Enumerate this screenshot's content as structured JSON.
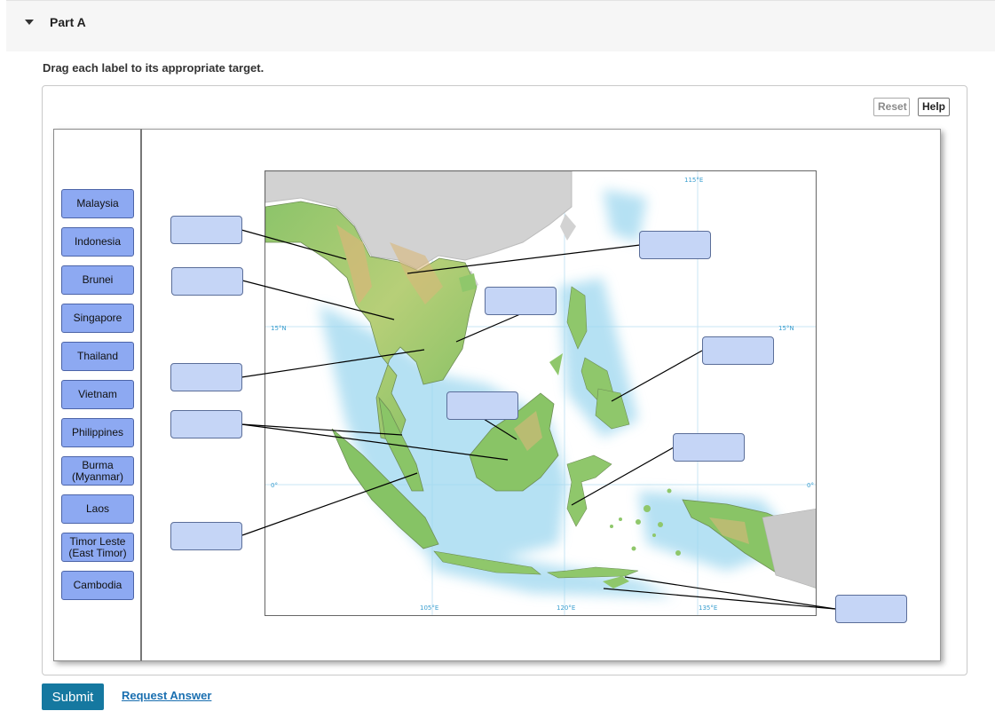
{
  "part": {
    "title": "Part A"
  },
  "instruction": "Drag each label to its appropriate target.",
  "toolbar": {
    "reset_label": "Reset",
    "help_label": "Help"
  },
  "labels": [
    "Malaysia",
    "Indonesia",
    "Brunei",
    "Singapore",
    "Thailand",
    "Vietnam",
    "Philippines",
    "Burma (Myanmar)",
    "Laos",
    "Timor Leste (East Timor)",
    "Cambodia"
  ],
  "map": {
    "coordinate_labels": [
      "115°E",
      "15°N",
      "15°N",
      "0°",
      "0°",
      "105°E",
      "120°E",
      "135°E"
    ]
  },
  "footer": {
    "submit_label": "Submit",
    "request_answer_label": "Request Answer"
  }
}
